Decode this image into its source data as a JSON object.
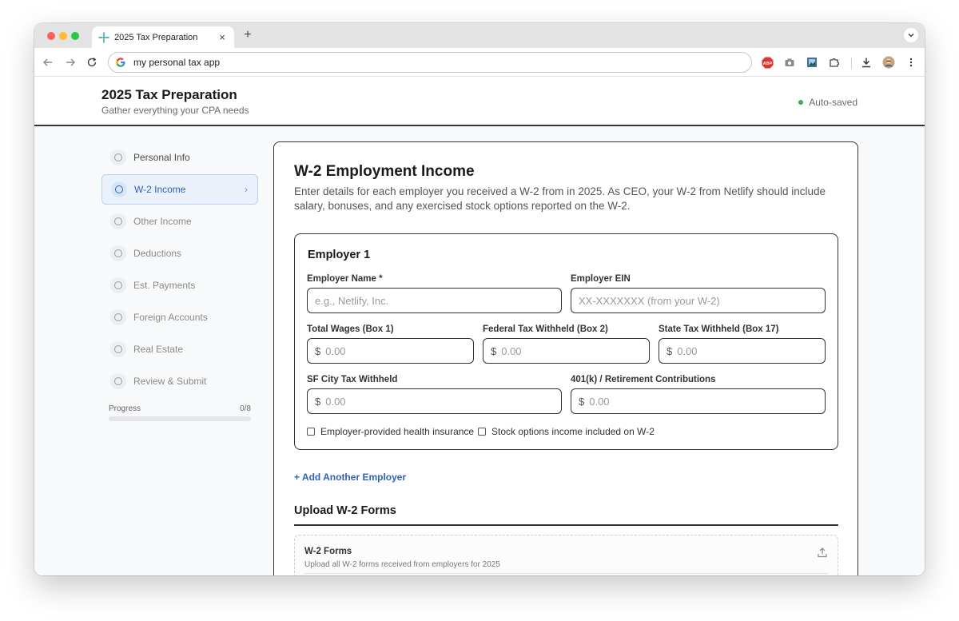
{
  "browser": {
    "tab_title": "2025 Tax Preparation",
    "address": "my personal tax app"
  },
  "header": {
    "title": "2025 Tax Preparation",
    "subtitle": "Gather everything your CPA needs",
    "status": "Auto-saved",
    "status_color": "#37b24d"
  },
  "sidebar": {
    "items": [
      {
        "label": "Personal Info"
      },
      {
        "label": "W-2 Income",
        "active": true
      },
      {
        "label": "Other Income"
      },
      {
        "label": "Deductions"
      },
      {
        "label": "Est. Payments"
      },
      {
        "label": "Foreign Accounts"
      },
      {
        "label": "Real Estate"
      },
      {
        "label": "Review & Submit"
      }
    ],
    "progress_label": "Progress",
    "progress_count": "0/8",
    "progress_fraction": 0
  },
  "main": {
    "title": "W-2 Employment Income",
    "description": "Enter details for each employer you received a W-2 from in 2025. As CEO, your W-2 from Netlify should include salary, bonuses, and any exercised stock options reported on the W-2.",
    "employer": {
      "title": "Employer 1",
      "fields": {
        "name": {
          "label": "Employer Name *",
          "placeholder": "e.g., Netlify, Inc."
        },
        "ein": {
          "label": "Employer EIN",
          "placeholder": "XX-XXXXXXX (from your W-2)"
        },
        "wages": {
          "label": "Total Wages (Box 1)",
          "currency": "$",
          "placeholder": "0.00"
        },
        "federal": {
          "label": "Federal Tax Withheld (Box 2)",
          "currency": "$",
          "placeholder": "0.00"
        },
        "state": {
          "label": "State Tax Withheld (Box 17)",
          "currency": "$",
          "placeholder": "0.00"
        },
        "city": {
          "label": "SF City Tax Withheld",
          "currency": "$",
          "placeholder": "0.00"
        },
        "retirement": {
          "label": "401(k) / Retirement Contributions",
          "currency": "$",
          "placeholder": "0.00"
        }
      },
      "checkboxes": {
        "health": "Employer-provided health insurance",
        "stock": "Stock options income included on W-2"
      }
    },
    "add_employer": "+ Add Another Employer",
    "upload": {
      "section_title": "Upload W-2 Forms",
      "box_title": "W-2 Forms",
      "box_subtitle": "Upload all W-2 forms received from employers for 2025"
    }
  },
  "colors": {
    "accent": "#2f62b5",
    "active_bg": "#eaf1fb",
    "border_dark": "#333333"
  }
}
